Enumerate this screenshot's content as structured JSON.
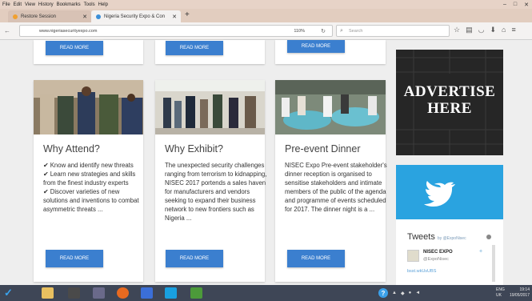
{
  "menubar": [
    "File",
    "Edit",
    "View",
    "History",
    "Bookmarks",
    "Tools",
    "Help"
  ],
  "window_controls": [
    "–",
    "□",
    "✕"
  ],
  "tabs": [
    {
      "label": "Restore Session"
    },
    {
      "label": "Nigeria Security Expo & Con"
    }
  ],
  "new_tab": "+",
  "url": "www.nigeriasecurityexpo.com",
  "zoom": "110%",
  "search_placeholder": "Search",
  "top_buttons": [
    "READ MORE",
    "READ MORE",
    "READ MORE"
  ],
  "cards": [
    {
      "title": "Why Attend?",
      "items": [
        "✔ Know and identify new threats",
        "✔ Learn new strategies and skills from the finest industry experts",
        "✔ Discover varieties of new solutions and inventions to combat asymmetric threats ..."
      ],
      "button": "READ MORE"
    },
    {
      "title": "Why Exhibit?",
      "text": "The unexpected security challenges ranging from terrorism to kidnapping, NISEC 2017 portends a sales haven for manufacturers and vendors seeking to expand their business network to new frontiers such as Nigeria ...",
      "button": "READ MORE"
    },
    {
      "title": "Pre-event Dinner",
      "text": "NISEC Expo Pre-event stakeholder's dinner reception is organised to sensitise stakeholders and intimate members of the public of the agenda and programme of events scheduled for 2017. The dinner night is a ...",
      "button": "READ MORE"
    }
  ],
  "advert": {
    "line1": "ADVERTISE",
    "line2": "HERE"
  },
  "twitter": {
    "title": "Tweets",
    "by": "by @ExpoNisec",
    "tweet_name": "NISEC EXPO",
    "tweet_handle": "@ExpoNisec",
    "tweet_link": "bsst.wkUsUBS"
  },
  "taskbar": {
    "lang": "ENG",
    "region": "UK",
    "time": "19:14",
    "date": "19/05/2017"
  },
  "colors": {
    "accent": "#3b7fcf",
    "twitter": "#2aa3e0",
    "advert_bg": "#232323",
    "taskbar": "#3e4656"
  }
}
